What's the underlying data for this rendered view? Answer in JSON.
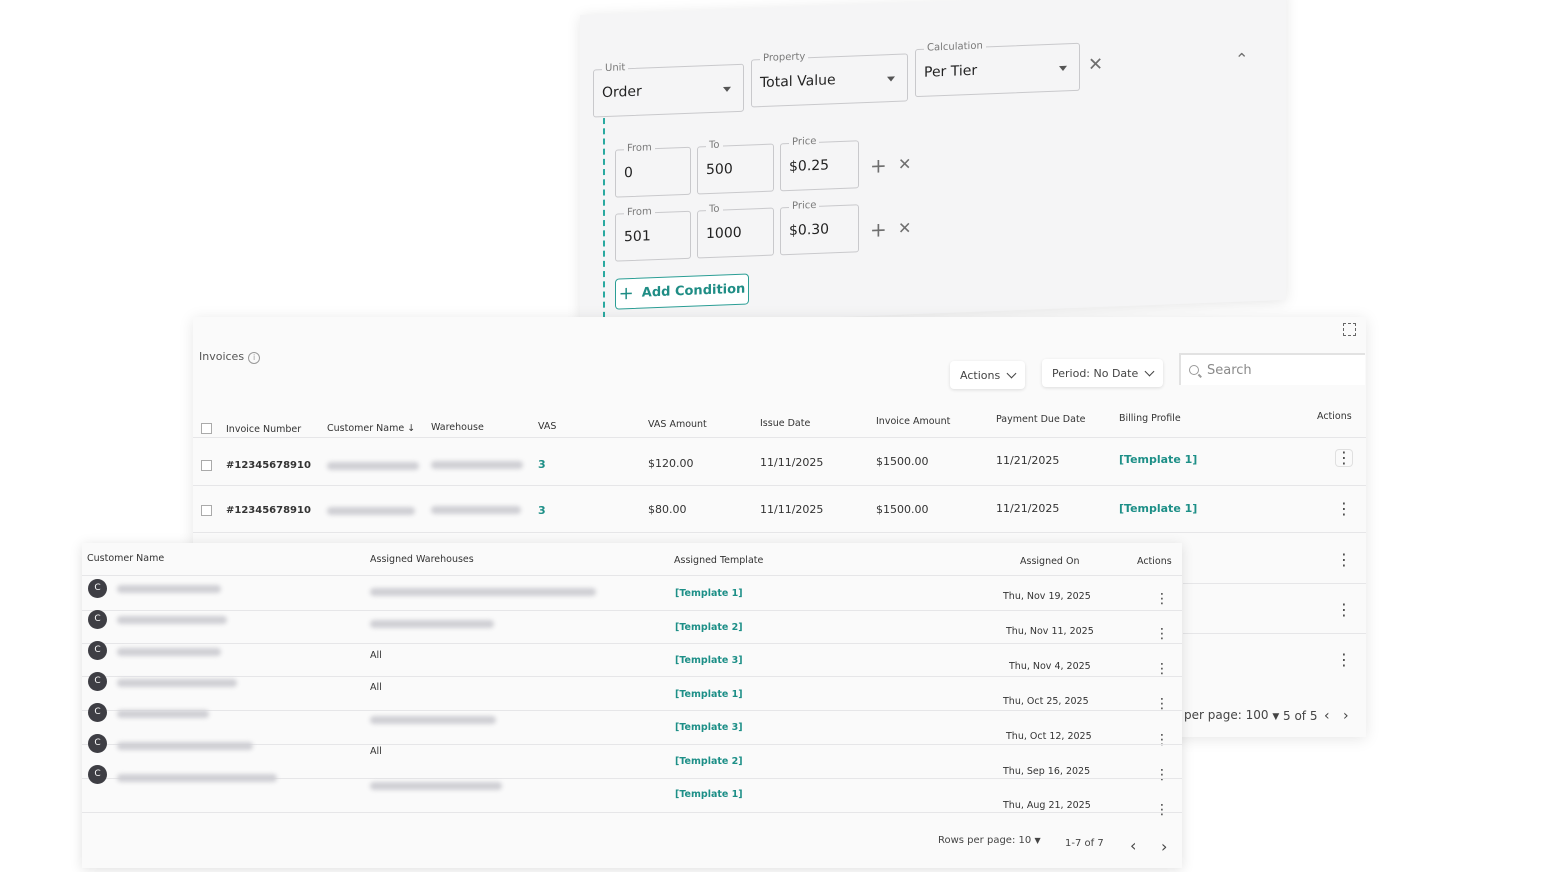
{
  "pricing": {
    "unit": {
      "label": "Unit",
      "value": "Order"
    },
    "property": {
      "label": "Property",
      "value": "Total Value"
    },
    "calculation": {
      "label": "Calculation",
      "value": "Per Tier"
    },
    "tiers": [
      {
        "from_label": "From",
        "from": "0",
        "to_label": "To",
        "to": "500",
        "price_label": "Price",
        "price": "$0.25"
      },
      {
        "from_label": "From",
        "from": "501",
        "to_label": "To",
        "to": "1000",
        "price_label": "Price",
        "price": "$0.30"
      }
    ],
    "add_condition_label": "Add Condition",
    "icons": {
      "add": "+",
      "remove": "✕",
      "collapse": "⌃"
    }
  },
  "invoices": {
    "title": "Invoices",
    "actions_label": "Actions",
    "period_label": "Period: No Date",
    "search_placeholder": "Search",
    "columns": [
      "Invoice Number",
      "Customer Name",
      "Warehouse",
      "VAS",
      "VAS Amount",
      "Issue Date",
      "Invoice Amount",
      "Payment Due Date",
      "Billing Profile",
      "Actions"
    ],
    "rows": [
      {
        "invoice_number": "#12345678910",
        "vas": "3",
        "vas_amount": "$120.00",
        "issue_date": "11/11/2025",
        "invoice_amount": "$1500.00",
        "due_date": "11/21/2025",
        "billing_profile": "[Template 1]"
      },
      {
        "invoice_number": "#12345678910",
        "vas": "3",
        "vas_amount": "$80.00",
        "issue_date": "11/11/2025",
        "invoice_amount": "$1500.00",
        "due_date": "11/21/2025",
        "billing_profile": "[Template 1]"
      }
    ],
    "pagination": {
      "per_page_text": "per page: 100",
      "range": "5 of 5"
    }
  },
  "assignments": {
    "columns": [
      "Customer Name",
      "Assigned Warehouses",
      "Assigned Template",
      "Assigned On",
      "Actions"
    ],
    "rows": [
      {
        "avatar": "C",
        "warehouses": "",
        "template": "[Template 1]",
        "assigned_on": "Thu, Nov 19, 2025"
      },
      {
        "avatar": "C",
        "warehouses": "",
        "template": "[Template 2]",
        "assigned_on": "Thu, Nov 11, 2025"
      },
      {
        "avatar": "C",
        "warehouses": "All",
        "template": "[Template 3]",
        "assigned_on": "Thu, Nov 4, 2025"
      },
      {
        "avatar": "C",
        "warehouses": "All",
        "template": "[Template 1]",
        "assigned_on": "Thu, Oct 25, 2025"
      },
      {
        "avatar": "C",
        "warehouses": "",
        "template": "[Template 3]",
        "assigned_on": "Thu, Oct 12, 2025"
      },
      {
        "avatar": "C",
        "warehouses": "All",
        "template": "[Template 2]",
        "assigned_on": "Thu, Sep 16, 2025"
      },
      {
        "avatar": "C",
        "warehouses": "",
        "template": "[Template 1]",
        "assigned_on": "Thu, Aug 21, 2025"
      }
    ],
    "pagination": {
      "rows_per_page_label": "Rows per page:",
      "rows_per_page_value": "10",
      "range": "1-7 of 7"
    }
  },
  "colors": {
    "accent": "#1d8f87",
    "avatar_bg": "#3e3e44",
    "dashed_line": "#2aa9a0"
  }
}
